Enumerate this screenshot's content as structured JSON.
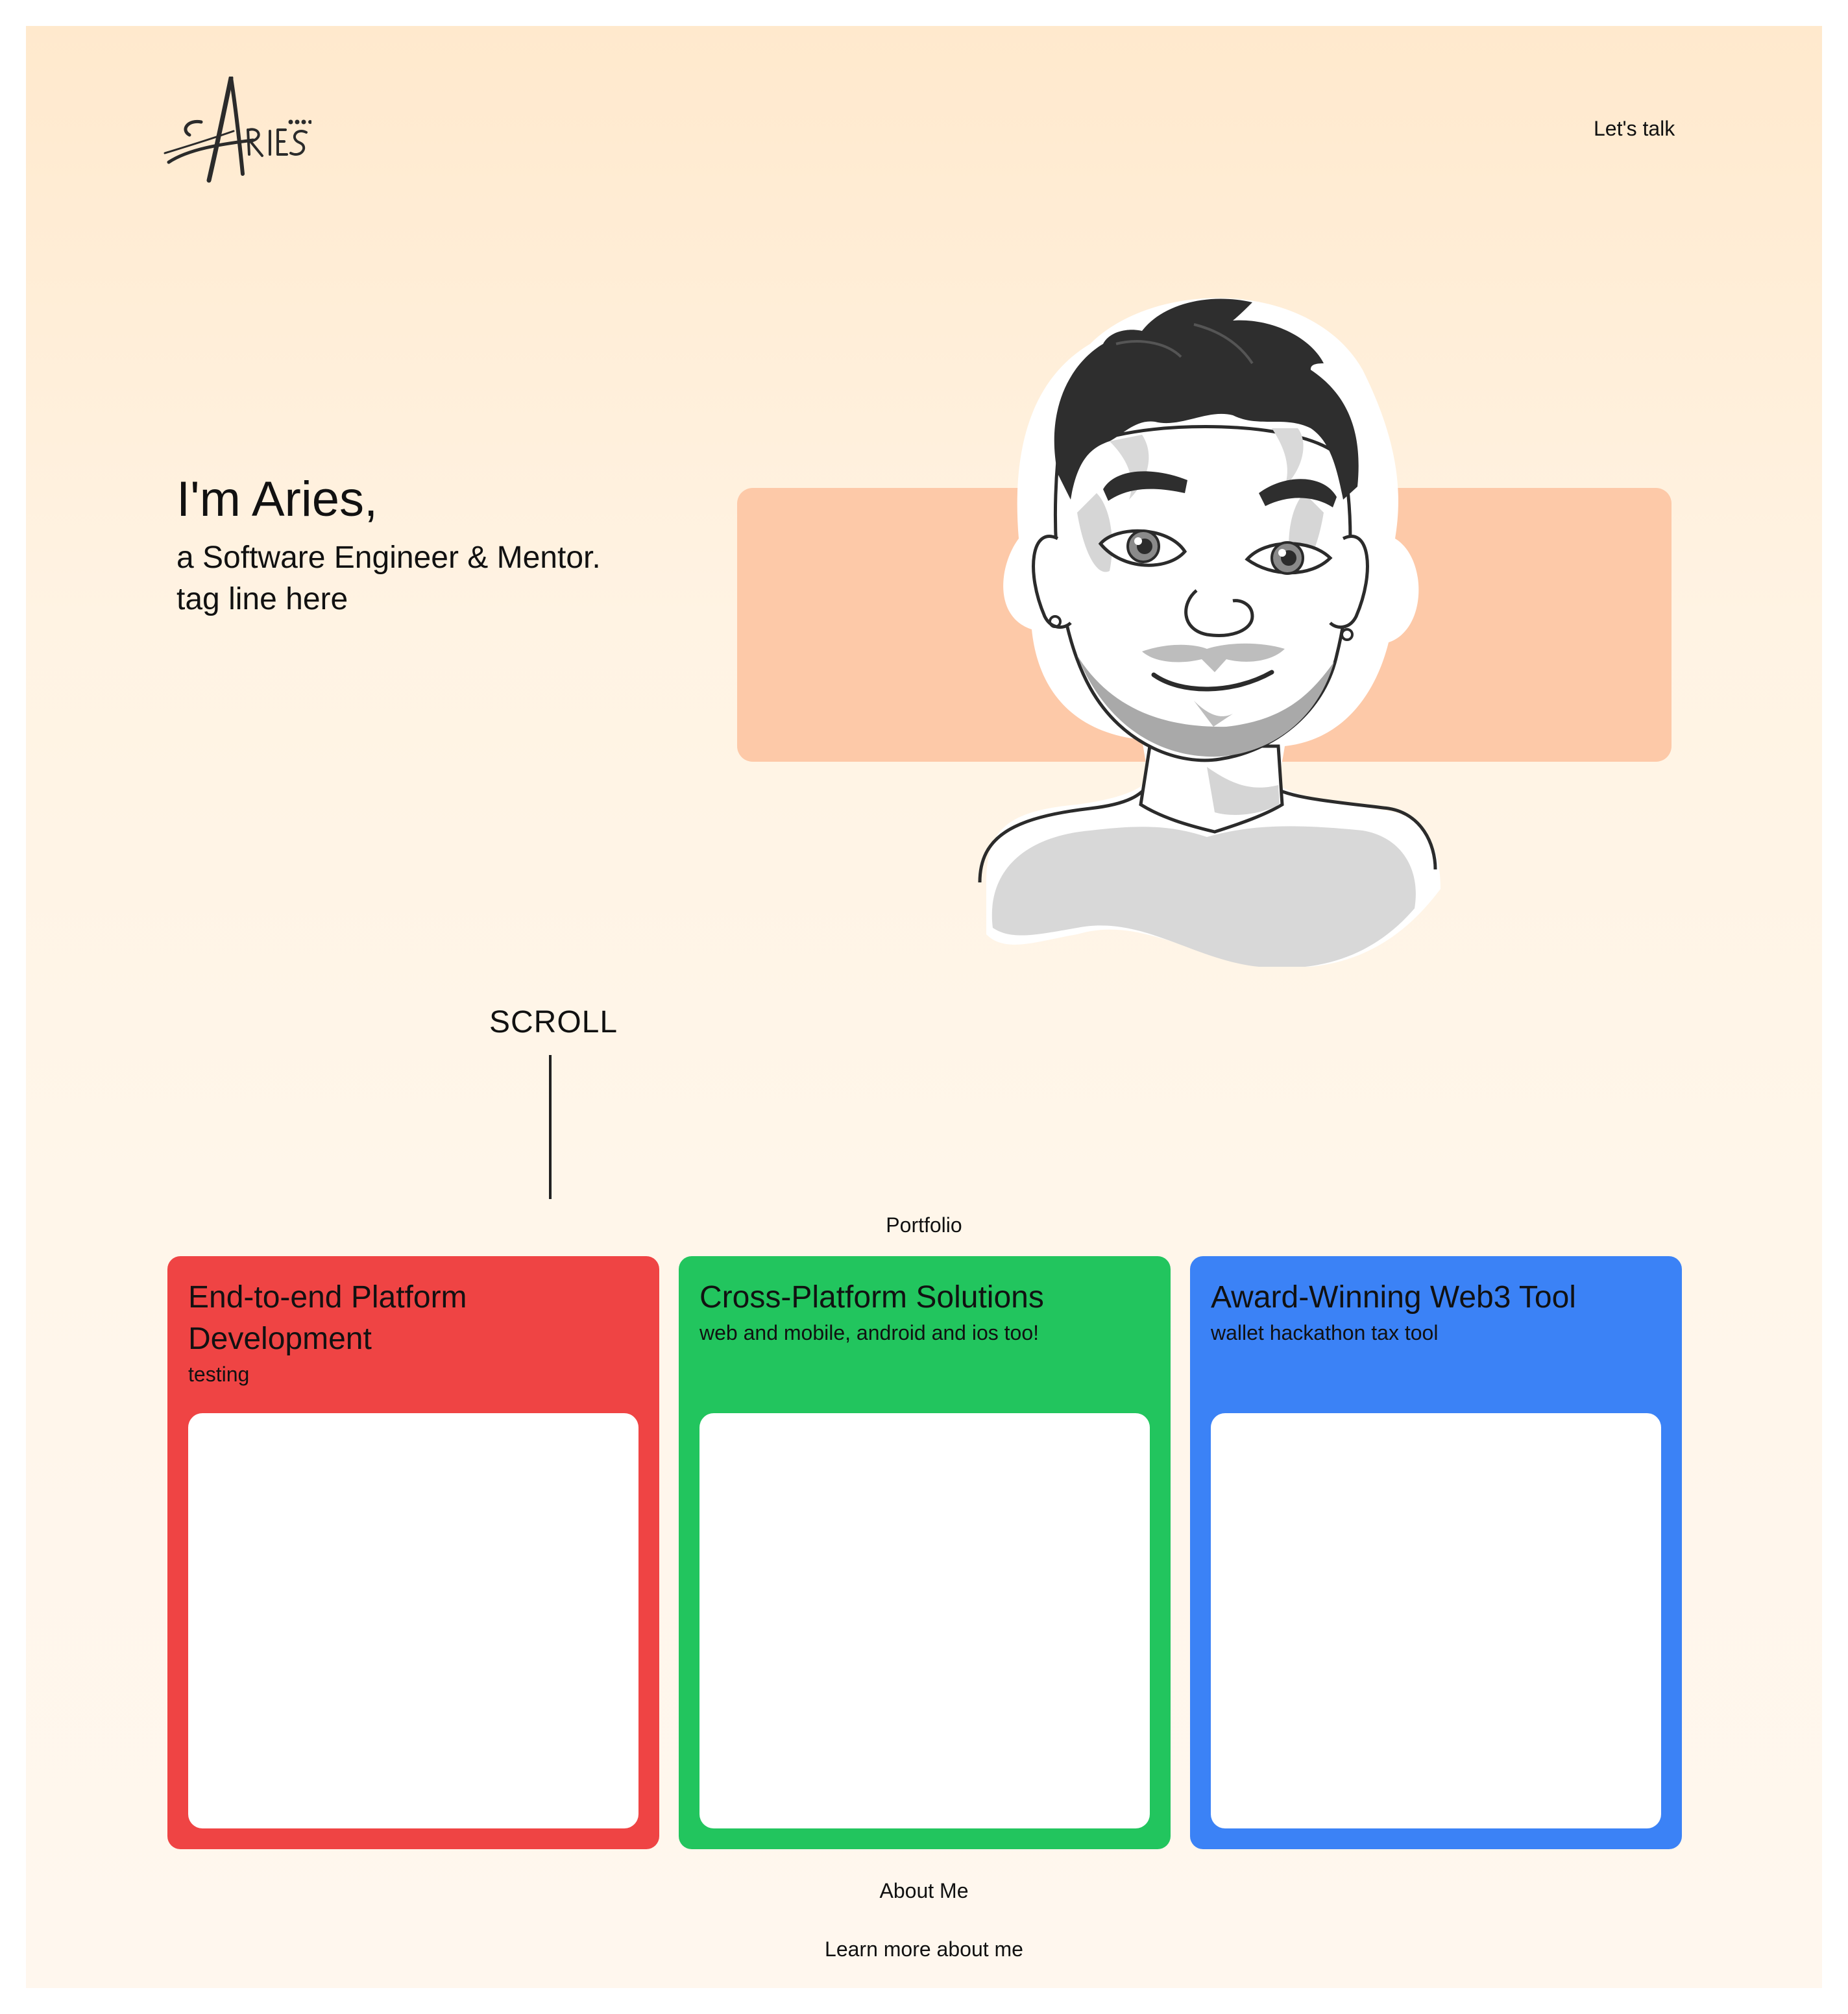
{
  "header": {
    "logo_text": "Aries",
    "nav_link": "Let's talk"
  },
  "hero": {
    "title": "I'm Aries,",
    "subtitle": "a Software Engineer & Mentor.",
    "tagline": "tag line here",
    "scroll_label": "SCROLL"
  },
  "portfolio": {
    "heading": "Portfolio",
    "cards": [
      {
        "title": "End-to-end Platform Development",
        "description": "testing",
        "color": "#ef4444"
      },
      {
        "title": "Cross-Platform Solutions",
        "description": "web and mobile, android and ios too!",
        "color": "#22c55e"
      },
      {
        "title": "Award-Winning Web3 Tool",
        "description": "wallet hackathon tax tool",
        "color": "#3b82f6"
      }
    ]
  },
  "about": {
    "heading": "About Me",
    "link": "Learn more about me"
  },
  "colors": {
    "accent_peach": "#fdc9a8",
    "background_top": "#ffe9cd",
    "background_bottom": "#fff7ee"
  }
}
